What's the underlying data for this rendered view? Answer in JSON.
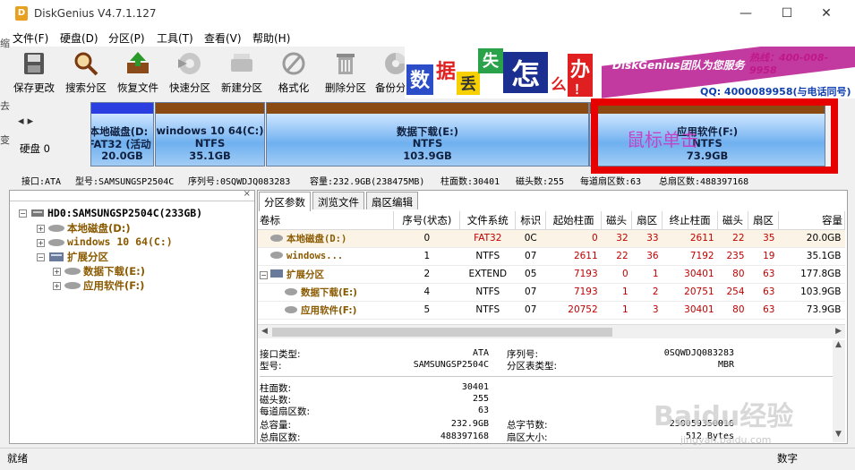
{
  "window": {
    "title": "DiskGenius V4.7.1.127",
    "app_icon": "D"
  },
  "menu": [
    "文件(F)",
    "硬盘(D)",
    "分区(P)",
    "工具(T)",
    "查看(V)",
    "帮助(H)"
  ],
  "toolbar": [
    "保存更改",
    "搜索分区",
    "恢复文件",
    "快速分区",
    "新建分区",
    "格式化",
    "删除分区",
    "备份分区"
  ],
  "banner": {
    "tiles": [
      "数",
      "据",
      "丢",
      "失",
      "怎",
      "么",
      "办",
      "！"
    ],
    "brand": "DiskGenius团队为您服务",
    "phone": "热线：400-008-9958",
    "qq": "QQ: 4000089958(与电话同号)"
  },
  "edge_letters": [
    "缩",
    "去",
    "变"
  ],
  "diskmap": {
    "disk_label": "硬盘 0",
    "partitions": [
      {
        "name": "本地磁盘(D:",
        "fs": "FAT32 (活动",
        "size": "20.0GB"
      },
      {
        "name": "windows 10  64(C:)",
        "fs": "NTFS",
        "size": "35.1GB"
      },
      {
        "name": "数据下载(E:)",
        "fs": "NTFS",
        "size": "103.9GB"
      },
      {
        "name": "应用软件(F:)",
        "fs": "NTFS",
        "size": "73.9GB"
      }
    ],
    "annotation": "鼠标单击"
  },
  "info_line": {
    "iface": "接口:ATA",
    "model": "型号:SAMSUNGSP2504C",
    "serial": "序列号:0SQWDJQ083283",
    "capacity": "容量:232.9GB(238475MB)",
    "cylinders": "柱面数:30401",
    "heads": "磁头数:255",
    "sectors": "每道扇区数:63",
    "total": "总扇区数:488397168"
  },
  "tree": {
    "disk": "HD0:SAMSUNGSP2504C(233GB)",
    "items": [
      "本地磁盘(D:)",
      "windows 10  64(C:)",
      "扩展分区",
      "数据下载(E:)",
      "应用软件(F:)"
    ]
  },
  "tabs": [
    "分区参数",
    "浏览文件",
    "扇区编辑"
  ],
  "table": {
    "headers": [
      "卷标",
      "序号(状态)",
      "文件系统",
      "标识",
      "起始柱面",
      "磁头",
      "扇区",
      "终止柱面",
      "磁头",
      "扇区",
      "容量"
    ],
    "rows": [
      [
        "本地磁盘(D:)",
        "0",
        "FAT32",
        "0C",
        "0",
        "32",
        "33",
        "2611",
        "22",
        "35",
        "20.0GB"
      ],
      [
        "windows...",
        "1",
        "NTFS",
        "07",
        "2611",
        "22",
        "36",
        "7192",
        "235",
        "19",
        "35.1GB"
      ],
      [
        "扩展分区",
        "2",
        "EXTEND",
        "05",
        "7193",
        "0",
        "1",
        "30401",
        "80",
        "63",
        "177.8GB"
      ],
      [
        "数据下载(E:)",
        "4",
        "NTFS",
        "07",
        "7193",
        "1",
        "2",
        "20751",
        "254",
        "63",
        "103.9GB"
      ],
      [
        "应用软件(F:)",
        "5",
        "NTFS",
        "07",
        "20752",
        "1",
        "3",
        "30401",
        "80",
        "63",
        "73.9GB"
      ]
    ]
  },
  "details": {
    "iface_label": "接口类型:",
    "iface": "ATA",
    "serial_label": "序列号:",
    "serial": "0SQWDJQ083283",
    "model_label": "型号:",
    "model": "SAMSUNGSP2504C",
    "ptable_label": "分区表类型:",
    "ptable": "MBR",
    "cyl_label": "柱面数:",
    "cyl": "30401",
    "heads_label": "磁头数:",
    "heads": "255",
    "spt_label": "每道扇区数:",
    "spt": "63",
    "cap_label": "总容量:",
    "cap": "232.9GB",
    "bytes_label": "总字节数:",
    "bytes": "250059350016",
    "sectors_label": "总扇区数:",
    "sectors": "488397168",
    "secsize_label": "扇区大小:",
    "secsize": "512 Bytes"
  },
  "status": {
    "left": "就绪",
    "right": "数字"
  },
  "watermark": {
    "main": "Baidu经验",
    "sub": "jingyan.baidu.com"
  }
}
